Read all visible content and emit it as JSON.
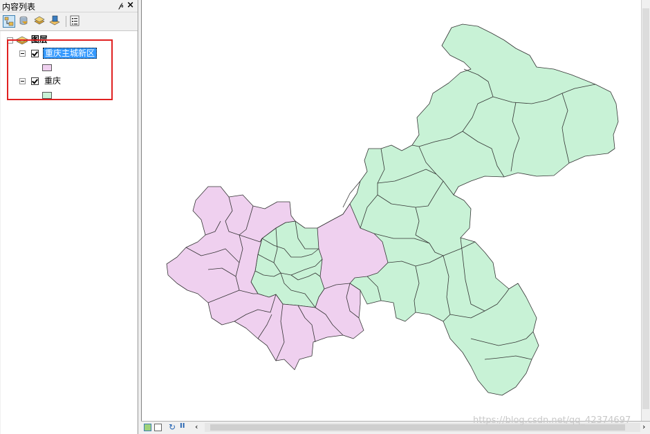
{
  "toc": {
    "title": "内容列表",
    "pin_glyph": "ᵽ",
    "close_glyph": "✕",
    "toolbar": [
      "list-by-drawing-order",
      "list-by-source",
      "list-by-visibility",
      "list-by-selection",
      "options"
    ],
    "layers_root": "图层",
    "layers": [
      {
        "name": "重庆主城新区",
        "checked": true,
        "swatch": "#efd0ef",
        "selected": true
      },
      {
        "name": "重庆",
        "checked": true,
        "swatch": "#c8f2d6",
        "selected": false
      }
    ]
  },
  "map": {
    "fill_main_city": "#efd0ef",
    "fill_chongqing": "#c8f2d6",
    "outline": "#333333"
  },
  "watermark": "https://blog.csdn.net/qq_42374697",
  "statusbar": {
    "icons": [
      "data-view",
      "layout-view",
      "refresh",
      "pause"
    ]
  }
}
